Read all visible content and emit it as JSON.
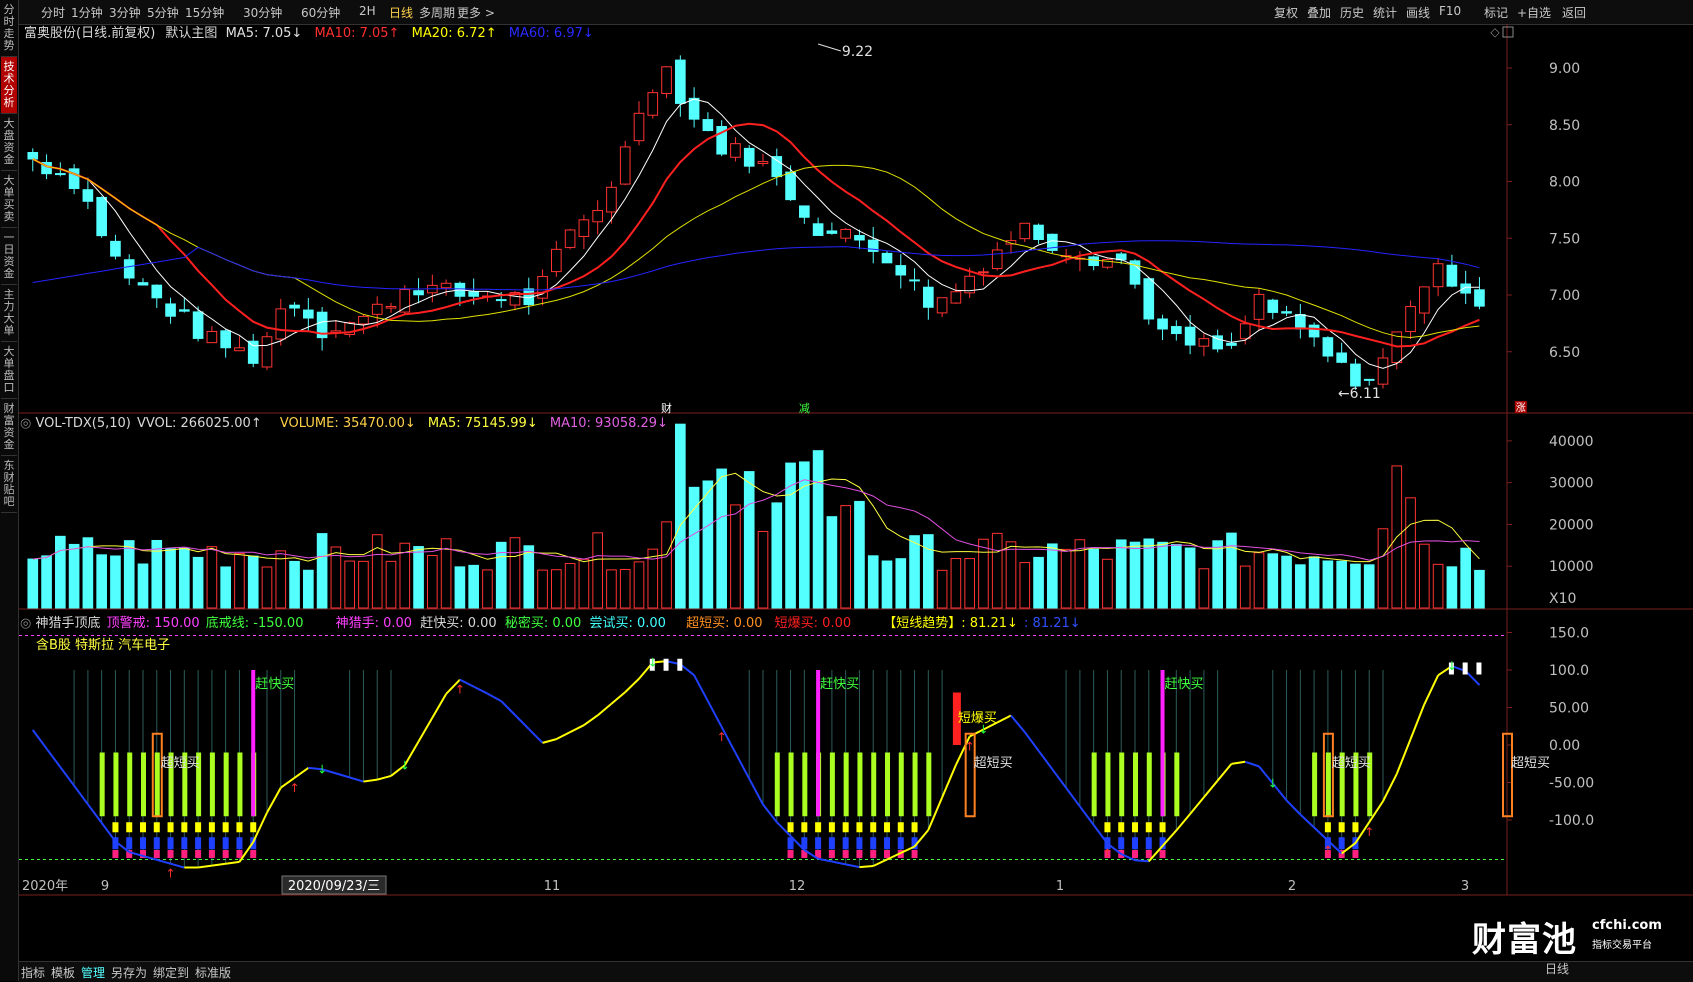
{
  "sidebar": {
    "items": [
      "分时走势",
      "技术分析",
      "大盘资金",
      "大单买卖",
      "一日资金",
      "主力大单",
      "大单盘口",
      "财富资金",
      "东财贴吧"
    ],
    "active_index": 1
  },
  "toolbar": {
    "periods": [
      "分时",
      "1分钟",
      "3分钟",
      "5分钟",
      "15分钟",
      "30分钟",
      "60分钟",
      "2H",
      "日线",
      "多周期",
      "更多 >"
    ],
    "active_period": "日线",
    "right_items": [
      "复权",
      "叠加",
      "历史",
      "统计",
      "画线",
      "F10",
      "标记",
      "+自选",
      "返回"
    ]
  },
  "main_chart": {
    "stock_name": "富奥股份(日线.前复权)",
    "template": "默认主图",
    "ma5": "MA5: 7.05↓",
    "ma10": "MA10: 7.05↑",
    "ma20": "MA20: 6.72↑",
    "ma60": "MA60: 6.97↓",
    "high_label": "9.22",
    "low_label": "6.11",
    "marker_cai": "财",
    "marker_jian": "减",
    "marker_zhang": "涨",
    "y_ticks": [
      "9.00",
      "8.50",
      "8.00",
      "7.50",
      "7.00",
      "6.50"
    ]
  },
  "volume_panel": {
    "indicator": "VOL-TDX(5,10)",
    "vvol": "VVOL: 266025.00↑",
    "volume": "VOLUME: 35470.00↓",
    "ma5": "MA5: 75145.99↓",
    "ma10": "MA10: 93058.29↓",
    "y_ticks": [
      "40000",
      "30000",
      "20000",
      "10000",
      "X10"
    ]
  },
  "indicator_panel": {
    "name": "神猎手顶底",
    "top_warn": "顶警戒: 150.00",
    "bottom_line": "底戒线: -150.00",
    "hunter": "神猎手: 0.00",
    "fast_buy": "赶快买: 0.00",
    "secret_buy": "秘密买: 0.00",
    "try_buy": "尝试买: 0.00",
    "super_short": "超短买: 0.00",
    "short_burst": "短爆买: 0.00",
    "trend": "【短线趋势】: 81.21↓",
    "trend2": ": 81.21↓",
    "concepts": "含B股 特斯拉 汽车电子",
    "label_fast": "赶快买",
    "label_super": "超短买",
    "label_burst": "短爆买",
    "y_ticks": [
      "150.0",
      "100.0",
      "50.00",
      "0.00",
      "-50.00",
      "-100.0"
    ]
  },
  "x_axis": {
    "year": "2020年",
    "labels": [
      "9",
      "11",
      "12",
      "1",
      "2",
      "3"
    ],
    "cursor_date": "2020/09/23/三"
  },
  "bottombar": {
    "items": [
      "指标",
      "模板",
      "管理",
      "另存为",
      "绑定到",
      "标准版"
    ],
    "active_item": "管理",
    "right_label": "日线"
  },
  "watermark": {
    "brand": "财富池",
    "domain": "cfchi.com",
    "sub": "指标交易平台"
  },
  "colors": {
    "up": "#ff3333",
    "down": "#54ffff",
    "ma5": "#ffffff",
    "ma10": "#ff2020",
    "ma20": "#ffff00",
    "ma60": "#2020ff",
    "accent": "#ffd24a"
  }
}
